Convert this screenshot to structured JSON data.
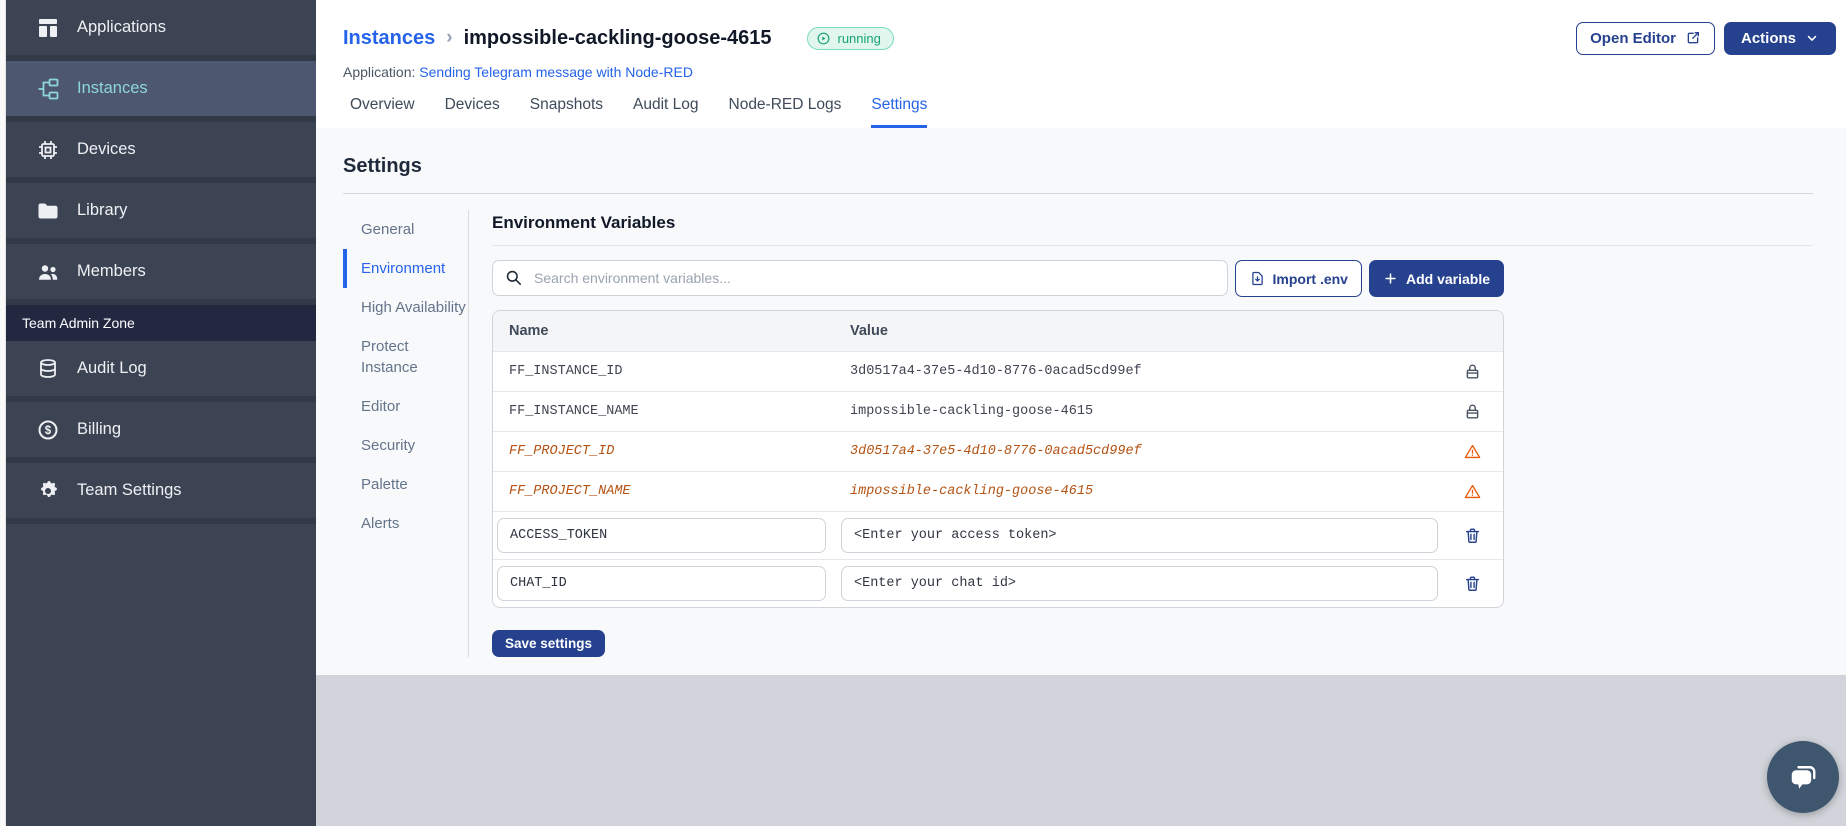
{
  "sidebar": {
    "items": [
      {
        "label": "Applications",
        "icon": "applications-icon"
      },
      {
        "label": "Instances",
        "icon": "instances-icon",
        "active": true
      },
      {
        "label": "Devices",
        "icon": "chip-icon"
      },
      {
        "label": "Library",
        "icon": "folder-icon"
      },
      {
        "label": "Members",
        "icon": "users-icon"
      }
    ],
    "zone_label": "Team Admin Zone",
    "admin_items": [
      {
        "label": "Audit Log",
        "icon": "database-icon"
      },
      {
        "label": "Billing",
        "icon": "dollar-icon"
      },
      {
        "label": "Team Settings",
        "icon": "gear-icon"
      }
    ]
  },
  "header": {
    "breadcrumb": {
      "root": "Instances",
      "separator": "›",
      "current": "impossible-cackling-goose-4615"
    },
    "status_badge": "running",
    "application_label": "Application:",
    "application_name": "Sending Telegram message with Node-RED",
    "buttons": {
      "open_editor": "Open Editor",
      "actions": "Actions"
    }
  },
  "tabs": [
    {
      "label": "Overview"
    },
    {
      "label": "Devices"
    },
    {
      "label": "Snapshots"
    },
    {
      "label": "Audit Log"
    },
    {
      "label": "Node-RED Logs"
    },
    {
      "label": "Settings",
      "active": true
    }
  ],
  "settings": {
    "title": "Settings",
    "nav": [
      {
        "label": "General"
      },
      {
        "label": "Environment",
        "active": true
      },
      {
        "label": "High Availability"
      },
      {
        "label": "Protect Instance"
      },
      {
        "label": "Editor"
      },
      {
        "label": "Security"
      },
      {
        "label": "Palette"
      },
      {
        "label": "Alerts"
      }
    ]
  },
  "environment": {
    "title": "Environment Variables",
    "search_placeholder": "Search environment variables...",
    "import_button": "Import .env",
    "add_button": "Add variable",
    "columns": {
      "name": "Name",
      "value": "Value"
    },
    "rows": [
      {
        "name": "FF_INSTANCE_ID",
        "value": "3d0517a4-37e5-4d10-8776-0acad5cd99ef",
        "state": "locked"
      },
      {
        "name": "FF_INSTANCE_NAME",
        "value": "impossible-cackling-goose-4615",
        "state": "locked"
      },
      {
        "name": "FF_PROJECT_ID",
        "value": "3d0517a4-37e5-4d10-8776-0acad5cd99ef",
        "state": "deprecated"
      },
      {
        "name": "FF_PROJECT_NAME",
        "value": "impossible-cackling-goose-4615",
        "state": "deprecated"
      },
      {
        "name": "ACCESS_TOKEN",
        "value": "<Enter your access token>",
        "state": "editable"
      },
      {
        "name": "CHAT_ID",
        "value": "<Enter your chat id>",
        "state": "editable"
      }
    ],
    "save_button": "Save settings"
  },
  "icons": {
    "sidebar": [
      "applications-icon",
      "instances-icon",
      "chip-icon",
      "folder-icon",
      "users-icon",
      "database-icon",
      "dollar-icon",
      "gear-icon"
    ],
    "header": [
      "play-circle-icon",
      "external-link-icon",
      "chevron-down-icon"
    ],
    "toolbar": [
      "search-icon",
      "import-env-icon",
      "plus-icon"
    ],
    "table": [
      "lock-icon",
      "warning-icon",
      "trash-icon"
    ],
    "misc": [
      "chat-bubbles-icon"
    ]
  },
  "colors": {
    "accent_blue": "#2563eb",
    "navy_button": "#26418e",
    "sidebar_bg": "#3c4454",
    "sidebar_active_bg": "#4d5870",
    "sidebar_teal": "#8dd6da",
    "zone_bg": "#212840",
    "running_bg": "#e1f7ee",
    "running_border": "#7adcbd",
    "running_text": "#17a374",
    "deprecated_text": "#b45313",
    "warning_icon": "#e8590c",
    "table_header_bg": "#f4f5f7",
    "footer_gray": "#d1d4da",
    "chat_bubble_bg": "#3e566e"
  }
}
